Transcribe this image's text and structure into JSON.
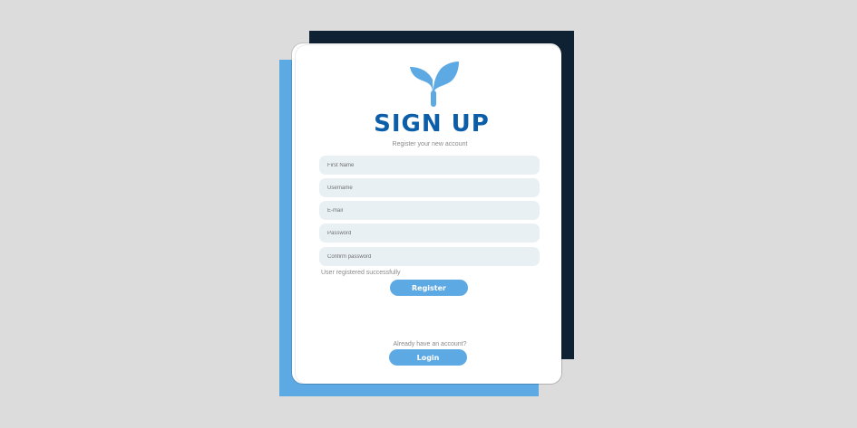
{
  "form": {
    "title": "SIGN UP",
    "subtitle": "Register your new account",
    "logo_icon": "sprout-icon",
    "fields": {
      "first_name": {
        "placeholder": "First Name",
        "value": ""
      },
      "username": {
        "placeholder": "Username",
        "value": ""
      },
      "email": {
        "placeholder": "E-mail",
        "value": ""
      },
      "password": {
        "placeholder": "Password",
        "value": ""
      },
      "confirm_password": {
        "placeholder": "Confirm password",
        "value": ""
      }
    },
    "status_message": "User registered successfully",
    "register_label": "Register",
    "login_prompt": "Already have an account?",
    "login_label": "Login"
  },
  "colors": {
    "background": "#dcdcdc",
    "accent": "#5ca9e3",
    "title": "#0d5ea8",
    "dark_panel": "#0f2233",
    "field_bg": "#e9f0f4"
  }
}
